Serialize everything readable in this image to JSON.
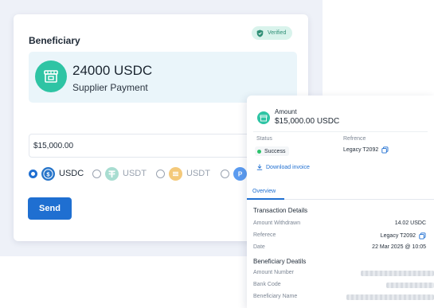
{
  "card": {
    "title": "Beneficiary",
    "verified_label": "Verified",
    "beneficiary": {
      "amount": "24000 USDC",
      "label": "Supplier Payment"
    },
    "amount_input": {
      "value": "$15,000.00"
    },
    "currency_options": [
      {
        "label": "USDC",
        "selected": true,
        "icon": "usdc-icon",
        "color": "#2775ca"
      },
      {
        "label": "USDT",
        "selected": false,
        "icon": "usdt-icon",
        "color": "#a8ddd1"
      },
      {
        "label": "USDT",
        "selected": false,
        "icon": "coin-icon",
        "color": "#f4c97a"
      },
      {
        "label": "",
        "selected": false,
        "icon": "coin-icon",
        "color": "#5a9bf0"
      }
    ],
    "send_label": "Send"
  },
  "detail": {
    "amount_label": "Amount",
    "amount_value": "$15,000.00 USDC",
    "status_label": "Status",
    "status_value": "Success",
    "reference_label": "Refrence",
    "reference_value": "Legacy T2092",
    "download_label": "Download invoice",
    "tab_overview": "Overview",
    "transaction_title": "Transaction Details",
    "transaction_rows": [
      {
        "label": "Amount Withdrawn",
        "value": "14.02 USDC"
      },
      {
        "label": "Referece",
        "value": "Legacy T2092"
      },
      {
        "label": "Date",
        "value": "22 Mar 2025 @ 10:05"
      }
    ],
    "beneficiary_title": "Beneficiary Deatils",
    "beneficiary_rows": [
      {
        "label": "Amount Number"
      },
      {
        "label": "Bank Code"
      },
      {
        "label": "Beneficiary Name"
      }
    ]
  },
  "colors": {
    "accent": "#1f6fd1",
    "teal": "#2ec4a4",
    "success": "#2cc36b",
    "verified_bg": "#d9f3ec"
  }
}
